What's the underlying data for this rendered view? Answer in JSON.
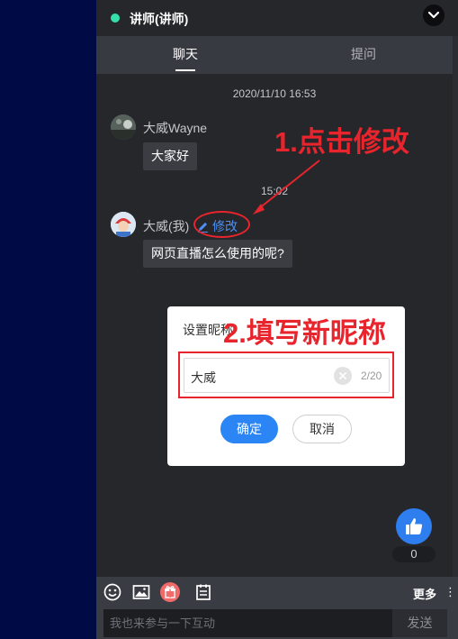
{
  "header": {
    "title": "讲师(讲师)",
    "status_color": "#35e0a8",
    "collapse_icon": "chevron-down-icon"
  },
  "tabs": [
    {
      "label": "聊天",
      "active": true
    },
    {
      "label": "提问",
      "active": false
    }
  ],
  "messages": {
    "timestamp1": "2020/11/10 16:53",
    "timestamp2": "15:02",
    "msg1": {
      "nick": "大威Wayne",
      "text": "大家好"
    },
    "msg2": {
      "nick": "大威(我)",
      "edit_label": "修改",
      "text": "网页直播怎么使用的呢?"
    }
  },
  "annotations": {
    "step1": "1.点击修改",
    "step2": "2.填写新昵称",
    "color": "#e8242c"
  },
  "dialog": {
    "title": "设置昵称",
    "input_value": "大威",
    "char_count": "2/20",
    "confirm_label": "确定",
    "cancel_label": "取消"
  },
  "like": {
    "count": "0"
  },
  "toolbar": {
    "icons": [
      "emoji-icon",
      "image-icon",
      "gift-icon",
      "notice-icon"
    ],
    "more_label": "更多",
    "more_icon": "⋮"
  },
  "composer": {
    "placeholder": "我也来参与一下互动",
    "send_label": "发送"
  },
  "colors": {
    "accent": "#2b85f5",
    "panel_bg": "#26272b",
    "page_bg": "#000a45"
  }
}
